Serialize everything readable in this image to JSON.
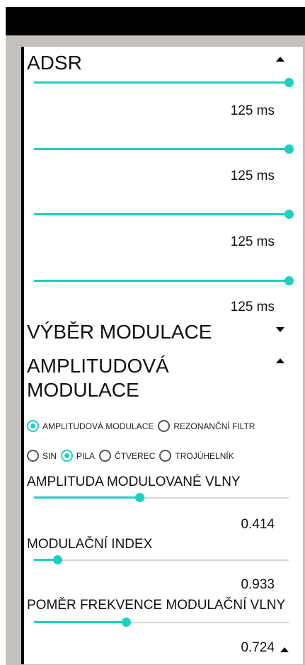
{
  "adsr": {
    "title": "ADSR",
    "sliders": [
      {
        "value_label": "125 ms",
        "fraction": 1.0
      },
      {
        "value_label": "125 ms",
        "fraction": 1.0
      },
      {
        "value_label": "125 ms",
        "fraction": 1.0
      },
      {
        "value_label": "125 ms",
        "fraction": 1.0
      }
    ]
  },
  "modulation_select": {
    "title": "VÝBĚR MODULACE"
  },
  "amplitude_modulation": {
    "title_line1": "AMPLITUDOVÁ",
    "title_line2": "MODULACE",
    "mode_options": [
      {
        "label": "AMPLITUDOVÁ MODULACE",
        "selected": true
      },
      {
        "label": "REZONANČNÍ FILTR",
        "selected": false
      }
    ],
    "wave_options": [
      {
        "label": "SIN",
        "selected": false
      },
      {
        "label": "PILA",
        "selected": true
      },
      {
        "label": "ČTVEREC",
        "selected": false
      },
      {
        "label": "TROJÚHELNÍK",
        "selected": false
      }
    ],
    "params": [
      {
        "label": "AMPLITUDA MODULOVANÉ VLNY",
        "value_label": "0.414",
        "fraction": 0.414
      },
      {
        "label": "MODULAČNÍ INDEX",
        "value_label": "0.933",
        "fraction": 0.093
      },
      {
        "label": "POMĚR FREKVENCE MODULAČNÍ VLNY",
        "value_label": "0.724",
        "fraction": 0.362
      }
    ]
  },
  "colors": {
    "accent": "#1ecfc0",
    "frame": "#c4c0bd",
    "statusbar": "#000000"
  }
}
